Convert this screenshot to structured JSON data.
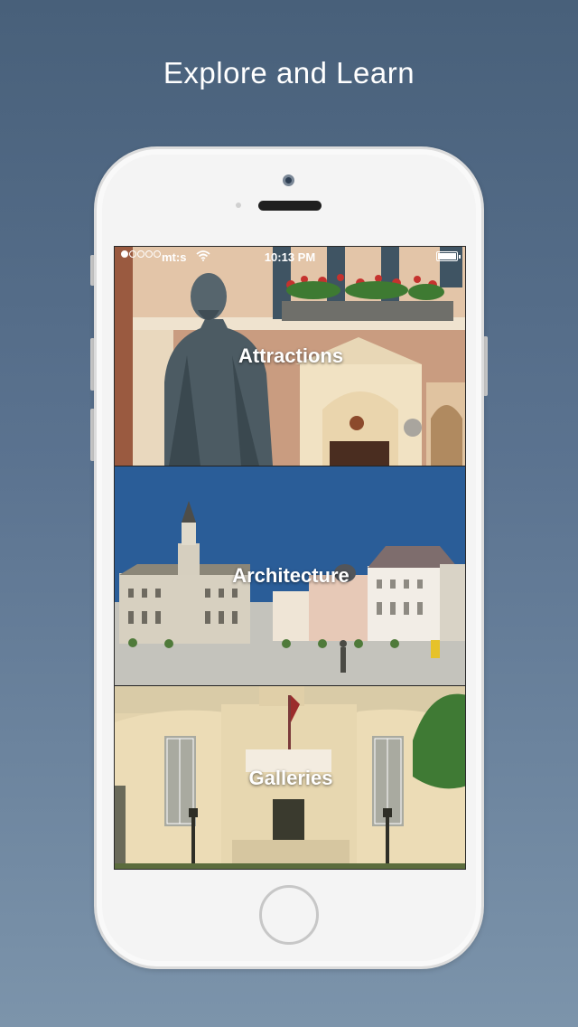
{
  "headline": "Explore and Learn",
  "status_bar": {
    "signal_dots_filled": 1,
    "signal_dots_total": 5,
    "carrier": "mt:s",
    "time": "10:13 PM",
    "wifi_icon": "wifi-icon",
    "battery_icon": "battery-icon",
    "battery_level": 1.0
  },
  "menu": {
    "items": [
      {
        "label": "Attractions",
        "icon": "statue-photo"
      },
      {
        "label": "Architecture",
        "icon": "town-square-photo"
      },
      {
        "label": "Galleries",
        "icon": "gallery-building-photo"
      }
    ]
  },
  "device": {
    "color": "#f4f4f4",
    "home_button_icon": "home-button"
  }
}
